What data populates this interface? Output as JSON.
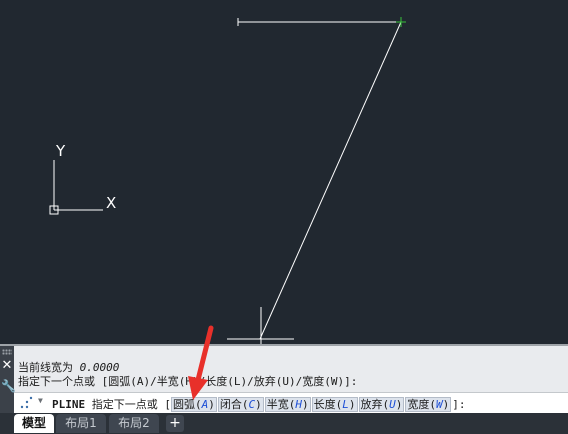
{
  "axis_icon": {
    "y_label": "Y",
    "x_label": "X"
  },
  "command": {
    "history_1_label": "当前线宽为 ",
    "history_1_value": "0.0000",
    "history_2": "指定下一个点或 [圆弧(A)/半宽(H)/长度(L)/放弃(U)/宽度(W)]:",
    "prompt_cmd": "PLINE",
    "prompt_text": " 指定下一点或 [",
    "options": [
      {
        "label": "圆弧",
        "key": "A"
      },
      {
        "label": "闭合",
        "key": "C"
      },
      {
        "label": "半宽",
        "key": "H"
      },
      {
        "label": "长度",
        "key": "L"
      },
      {
        "label": "放弃",
        "key": "U"
      },
      {
        "label": "宽度",
        "key": "W"
      }
    ],
    "prompt_end": "]:"
  },
  "tabs": [
    {
      "label": "模型",
      "active": true
    },
    {
      "label": "布局1",
      "active": false
    },
    {
      "label": "布局2",
      "active": false
    }
  ],
  "tab_add": "+",
  "icons": {
    "close": "close-icon",
    "settings": "wrench-icon",
    "command": "command-line-icon",
    "dropdown": "chevron-down-icon"
  },
  "colors": {
    "canvas": "#212830",
    "polyline": "#ffffff",
    "grip": "#37c13a",
    "option_key": "#1d4fd6",
    "pointer": "#e8302a"
  }
}
